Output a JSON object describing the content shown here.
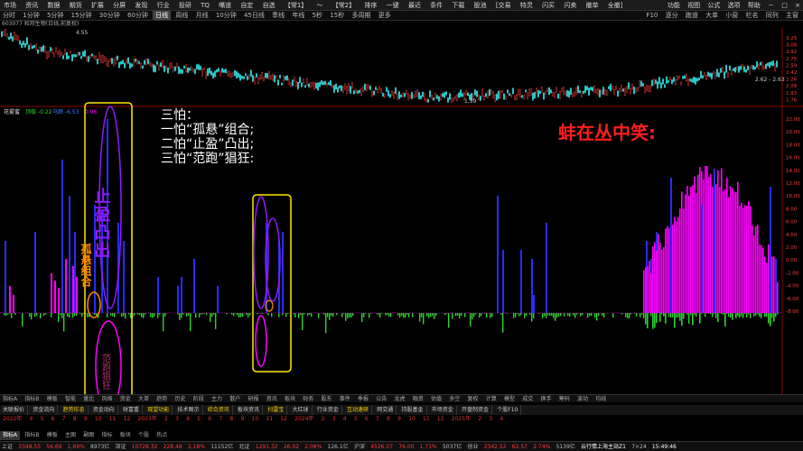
{
  "menubar": {
    "items": [
      "市场",
      "资讯",
      "数据",
      "期货",
      "扩展",
      "分屏",
      "发现",
      "行业",
      "投研",
      "TQ",
      "嘴道",
      "自定",
      "自选",
      "【常1】",
      "〜",
      "【常2】",
      "排序",
      "一键",
      "最近",
      "条件",
      "下载",
      "股池",
      "[交易",
      "特灵",
      "闪买",
      "闪卖",
      "撤单",
      "全撤]"
    ],
    "right": [
      "功能",
      "视图",
      "公式",
      "选项",
      "帮助",
      "－",
      "□",
      "×"
    ]
  },
  "periodbar": {
    "items": [
      "分时",
      "1分钟",
      "5分钟",
      "15分钟",
      "30分钟",
      "60分钟",
      "日线",
      "周线",
      "月线",
      "10分钟",
      "45日线",
      "季线",
      "年线",
      "5秒",
      "15秒",
      "多周期",
      "更多"
    ],
    "active_index": 6,
    "right": [
      "F10",
      "逐分",
      "跑道",
      "大单",
      "小窗",
      "栏名",
      "同列",
      "主窗"
    ]
  },
  "chartinfo": {
    "text": "603077 和邦生物(日线,前复权)",
    "high_label": "4.55",
    "low_label": "1.59",
    "range_label": "2.62 - 2.63"
  },
  "price_axis": [
    "3.25",
    "3.08",
    "2.92",
    "2.75",
    "2.59",
    "2.42",
    "2.26",
    "2.09",
    "1.93",
    "1.76"
  ],
  "indicator": {
    "name": "花雾蜜",
    "values": [
      "顶极 -0.22",
      "马蹄 -6.53",
      "0.96"
    ],
    "axis": [
      "22.00",
      "20.00",
      "18.00",
      "16.00",
      "14.00",
      "12.00",
      "10.00",
      "8.00",
      "6.00",
      "4.00",
      "2.00",
      "0.00",
      "-2.00",
      "-4.00",
      "-6.00",
      "-8.00"
    ]
  },
  "annotations": {
    "left_vertical": "止盈凸出",
    "left_small": "孤悬组合",
    "left_bottom": "范跑猖狂",
    "middle_title": "三怕：",
    "lines": [
      "一怕“孤悬”组合;",
      "二怕“止盈”凸出;",
      "三怕“范跑”猖狂:"
    ],
    "slogan": "蚌在丛中笑:"
  },
  "indicator_tabs": {
    "items": [
      "指标A",
      "指标B",
      "模板",
      "智能",
      "量比",
      "风格",
      "资金",
      "大单",
      "趋势",
      "历史",
      "阶段",
      "主力",
      "散户",
      "研报",
      "资讯",
      "板块",
      "财务",
      "股东",
      "事件",
      "季报",
      "公告",
      "龙虎",
      "融资",
      "估值",
      "多空",
      "复权",
      "计算",
      "模型",
      "成交",
      "换手",
      "筹码",
      "波动",
      "均线"
    ]
  },
  "tool_tabs": {
    "items": [
      "关联报价",
      "资金流向",
      "趋势形态",
      "资金动向",
      "财富重",
      "观望功能",
      "技术图示",
      "综合资讯",
      "板块资讯",
      "扫雷宝",
      "大红球",
      "行业资金",
      "互动速研",
      "网交通",
      "持股基金",
      "市场资金",
      "开盘制资金",
      "个股F10"
    ],
    "highlighted": [
      2,
      5,
      7,
      9,
      12
    ]
  },
  "dates_row": {
    "items": [
      "2022年",
      "4",
      "5",
      "6",
      "7",
      "8",
      "9",
      "10",
      "11",
      "12",
      "2023年",
      "2",
      "3",
      "4",
      "5",
      "6",
      "7",
      "8",
      "9",
      "10",
      "11",
      "12",
      "2024年",
      "2",
      "3",
      "4",
      "5",
      "6",
      "7",
      "8",
      "9",
      "10",
      "11",
      "12",
      "2025年",
      "2",
      "3",
      "4"
    ]
  },
  "bottom_tabs": {
    "items": [
      "指标A",
      "指标B",
      "模板",
      "主图",
      "副图",
      "指标",
      "板块",
      "个股",
      "热点"
    ],
    "selected": 0
  },
  "indices_row": {
    "items": [
      {
        "label": "上证",
        "value": "3348.55",
        "chg": "56.69",
        "pct": "1.69%",
        "amount": "8973亿",
        "color": "red"
      },
      {
        "label": "深证",
        "value": "10728.32",
        "chg": "228.48",
        "pct": "2.18%",
        "amount": "11152亿",
        "color": "red"
      },
      {
        "label": "北证",
        "value": "1291.32",
        "chg": "26.02",
        "pct": "2.08%",
        "amount": "126.1亿",
        "color": "red"
      },
      {
        "label": "沪深",
        "value": "4526.07",
        "chg": "76.00",
        "pct": "1.71%",
        "amount": "5037亿",
        "color": "red"
      },
      {
        "label": "创业",
        "value": "2342.52",
        "chg": "62.57",
        "pct": "2.74%",
        "amount": "5139亿",
        "color": "red"
      }
    ],
    "status": "云行情上海主站Z1",
    "time": "15:49:46",
    "extra": "7×24"
  }
}
